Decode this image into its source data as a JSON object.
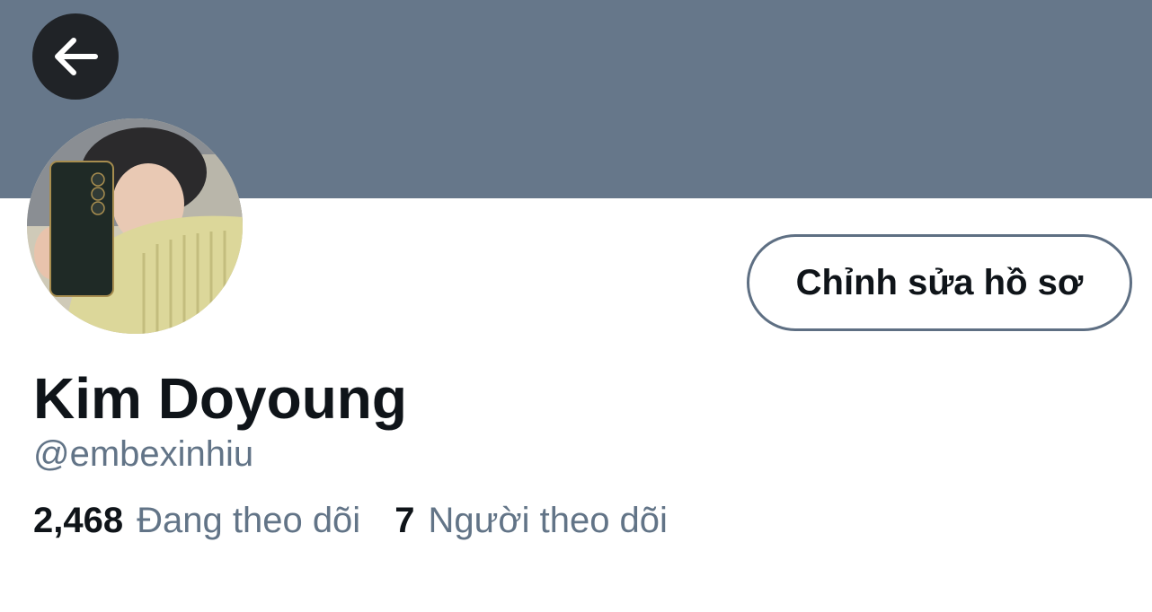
{
  "profile": {
    "display_name": "Kim Doyoung",
    "handle": "@embexinhiu",
    "edit_profile_label": "Chỉnh sửa hồ sơ",
    "following_count": "2,468",
    "following_label": "Đang theo dõi",
    "followers_count": "7",
    "followers_label": "Người theo dõi"
  },
  "icons": {
    "back": "arrow-left-icon"
  },
  "colors": {
    "banner": "#66778a",
    "back_button_bg": "#202327",
    "primary_text": "#0f1419",
    "secondary_text": "#627487",
    "button_border": "#5e6f83"
  }
}
